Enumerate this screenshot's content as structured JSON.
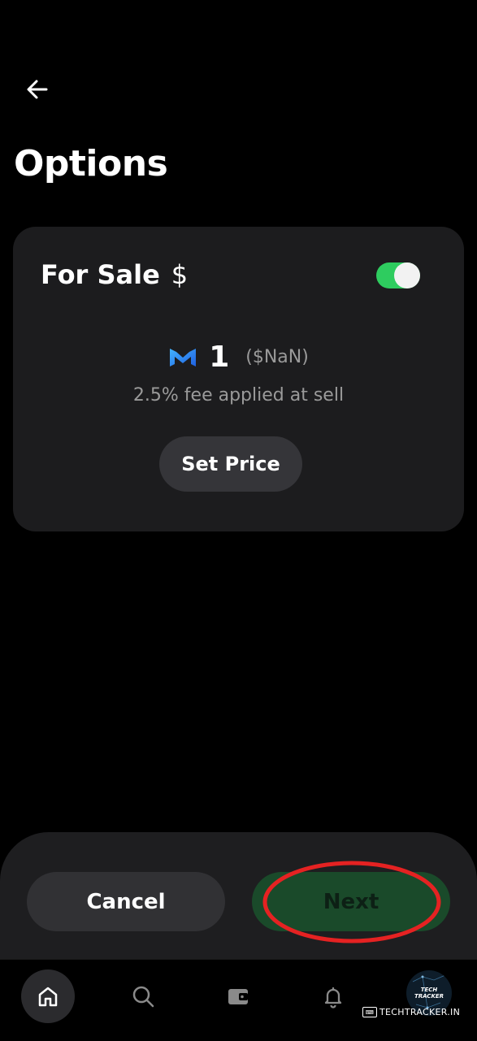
{
  "header": {
    "title": "Options"
  },
  "sale_card": {
    "label": "For Sale",
    "currency_symbol": "$",
    "toggle_on": true,
    "token_icon": "matic-icon",
    "price": "1",
    "fiat_value": "($NaN)",
    "fee_text": "2.5% fee applied at sell",
    "set_price_label": "Set Price"
  },
  "actions": {
    "cancel_label": "Cancel",
    "next_label": "Next"
  },
  "nav": {
    "items": [
      {
        "icon": "home-icon",
        "active": true
      },
      {
        "icon": "search-icon",
        "active": false
      },
      {
        "icon": "wallet-icon",
        "active": false
      },
      {
        "icon": "bell-icon",
        "active": false
      },
      {
        "icon": "avatar",
        "active": false
      }
    ],
    "avatar_text": "TECH TRACKER"
  },
  "watermark": {
    "text": "TECHTRACKER.IN"
  },
  "colors": {
    "toggle_on": "#2ecc5f",
    "next_button": "#1a4a2a",
    "highlight_ring": "#e52222",
    "card": "#1c1c1e"
  }
}
